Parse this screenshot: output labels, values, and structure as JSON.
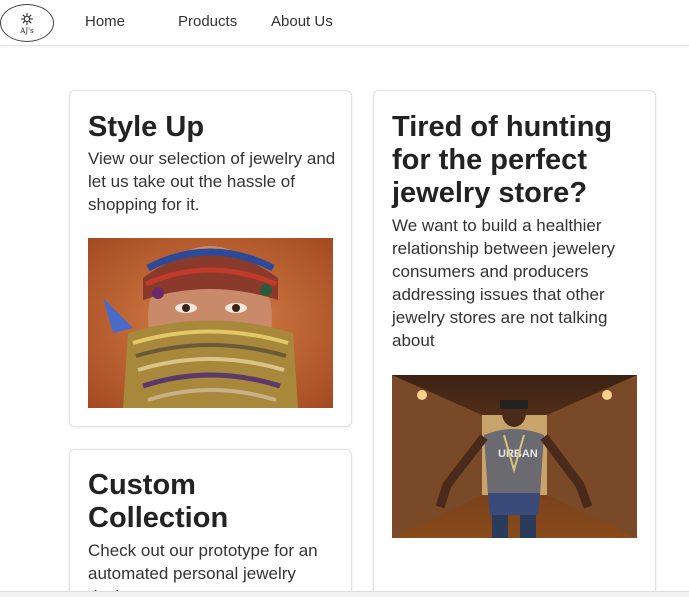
{
  "brand": {
    "logo_text": "AJ's"
  },
  "nav": {
    "items": [
      {
        "label": "Home"
      },
      {
        "label": "Products"
      },
      {
        "label": "About Us"
      }
    ]
  },
  "cards": {
    "style_up": {
      "title": "Style Up",
      "body": "View our selection of jewelry and let us take out the hassle of shopping for it."
    },
    "hunting": {
      "title": "Tired of hunting for the perfect jewelry store?",
      "body": "We want to build a healthier relationship between jewelery consumers and producers addressing issues that other jewelry stores are not talking about"
    },
    "custom": {
      "title": "Custom Collection",
      "body": "Check out our prototype for an automated personal jewelry designer"
    }
  },
  "photo_text": {
    "shirt_print": "URBAN"
  },
  "colors": {
    "nav_border": "#e6e6e6",
    "card_border": "#e2e2e2",
    "text": "#222222"
  }
}
